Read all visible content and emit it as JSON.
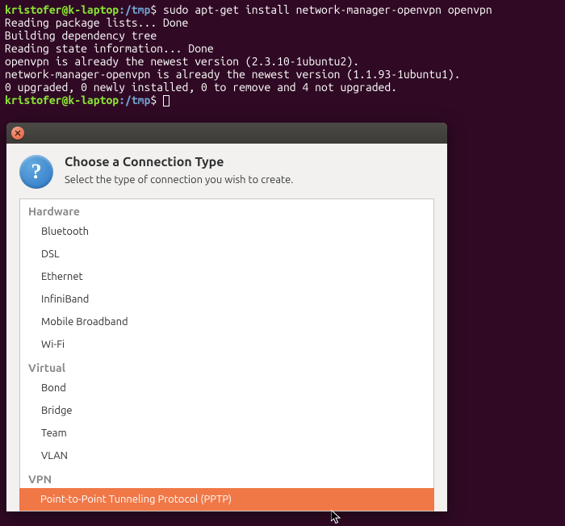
{
  "terminal": {
    "prompt": {
      "userhost": "kristofer@k-laptop",
      "colon": ":",
      "path": "/tmp",
      "dollar": "$"
    },
    "command": "sudo apt-get install network-manager-openvpn openvpn",
    "lines": [
      "Reading package lists... Done",
      "Building dependency tree",
      "Reading state information... Done",
      "openvpn is already the newest version (2.3.10-1ubuntu2).",
      "network-manager-openvpn is already the newest version (1.1.93-1ubuntu1).",
      "0 upgraded, 0 newly installed, 0 to remove and 4 not upgraded."
    ]
  },
  "dialog": {
    "title": "Choose a Connection Type",
    "subtitle": "Select the type of connection you wish to create.",
    "groups": [
      {
        "label": "Hardware",
        "items": [
          "Bluetooth",
          "DSL",
          "Ethernet",
          "InfiniBand",
          "Mobile Broadband",
          "Wi-Fi"
        ]
      },
      {
        "label": "Virtual",
        "items": [
          "Bond",
          "Bridge",
          "Team",
          "VLAN"
        ]
      },
      {
        "label": "VPN",
        "items": [
          "Point-to-Point Tunneling Protocol (PPTP)"
        ]
      }
    ],
    "selected": "Point-to-Point Tunneling Protocol (PPTP)"
  },
  "colors": {
    "bg": "#300a24",
    "prompt_user": "#8ae234",
    "prompt_path": "#729fcf",
    "selection": "#f07746",
    "dialog_bg": "#f2f1f0"
  }
}
